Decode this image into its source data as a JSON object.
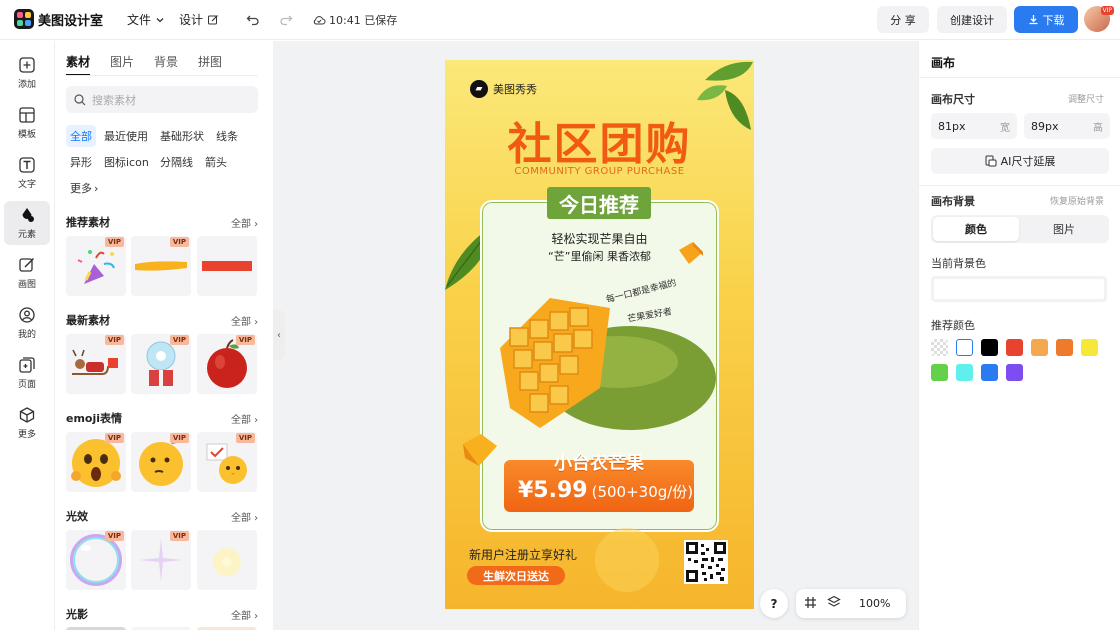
{
  "app": {
    "name": "美图设计室"
  },
  "toolbar": {
    "file_label": "文件",
    "design_label": "设计",
    "save_status": "10:41 已保存",
    "share_label": "分 享",
    "create_label": "创建设计",
    "download_label": "下载",
    "avatar_badge": "VIP"
  },
  "leftnav": [
    {
      "label": "添加",
      "icon": "add-icon"
    },
    {
      "label": "模板",
      "icon": "template-icon"
    },
    {
      "label": "文字",
      "icon": "text-icon"
    },
    {
      "label": "元素",
      "icon": "elements-icon"
    },
    {
      "label": "画图",
      "icon": "draw-icon"
    },
    {
      "label": "我的",
      "icon": "user-icon"
    },
    {
      "label": "页面",
      "icon": "page-icon"
    },
    {
      "label": "更多",
      "icon": "more-icon"
    }
  ],
  "panel": {
    "tabs": [
      "素材",
      "图片",
      "背景",
      "拼图"
    ],
    "search_placeholder": "搜索素材",
    "chips": [
      "全部",
      "最近使用",
      "基础形状",
      "线条",
      "异形",
      "图标icon",
      "分隔线",
      "箭头",
      "更多"
    ],
    "all_label": "全部",
    "vip_label": "VIP",
    "sections": [
      {
        "title": "推荐素材"
      },
      {
        "title": "最新素材"
      },
      {
        "title": "emoji表情"
      },
      {
        "title": "光效"
      },
      {
        "title": "光影"
      }
    ]
  },
  "poster": {
    "brand": "美图秀秀",
    "title": "社区团购",
    "subtitle": "COMMUNITY GROUP PURCHASE",
    "badge": "今日推荐",
    "line1": "轻松实现芒果自由",
    "line2": "“芒”里偷闲 果香浓郁",
    "handwrite1": "每一口都是幸福的",
    "handwrite2": "芒果爱好者",
    "product": "小台农芒果",
    "price": "¥5.99",
    "unit": "(500+30g/份)",
    "footer": "新用户注册立享好礼",
    "pill": "生鲜次日送达"
  },
  "right": {
    "title": "画布",
    "size_label": "画布尺寸",
    "resize_label": "调整尺寸",
    "width_value": "81px",
    "width_unit": "宽",
    "height_value": "89px",
    "height_unit": "高",
    "ai_extend_label": "AI尺寸延展",
    "bg_label": "画布背景",
    "restore_label": "恢复原始背景",
    "seg_color": "颜色",
    "seg_image": "图片",
    "current_bg_label": "当前背景色",
    "recommend_label": "推荐颜色",
    "swatches": [
      "transparent",
      "#ffffff",
      "#000000",
      "#e8432e",
      "#f5a94f",
      "#ee7a2c",
      "#f5e83a",
      "#63d24a",
      "#5ff0ee",
      "#2b7bf0",
      "#7c4df0"
    ]
  },
  "bottom": {
    "help": "?",
    "zoom": "100%"
  }
}
